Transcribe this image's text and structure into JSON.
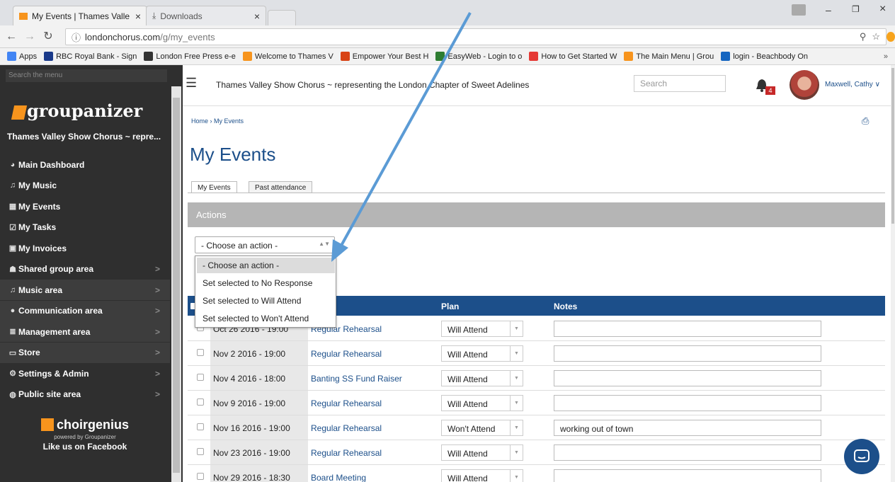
{
  "browser": {
    "tabs": [
      {
        "label": "My Events | Thames Valle"
      },
      {
        "label": "Downloads"
      }
    ],
    "url_prefix": "londonchorus.com",
    "url_path": "/g/my_events",
    "bookmarks": [
      {
        "label": "Apps",
        "color": "#4285f4"
      },
      {
        "label": "RBC Royal Bank - Sign",
        "color": "#1a3a8a"
      },
      {
        "label": "London Free Press e-e",
        "color": "#333333"
      },
      {
        "label": "Welcome to Thames V",
        "color": "#f7941d"
      },
      {
        "label": "Empower Your Best H",
        "color": "#d84315"
      },
      {
        "label": "EasyWeb - Login to o",
        "color": "#2e7d32"
      },
      {
        "label": "How to Get Started W",
        "color": "#e53935"
      },
      {
        "label": "The Main Menu | Grou",
        "color": "#f7941d"
      },
      {
        "label": "login - Beachbody On",
        "color": "#1565c0"
      }
    ],
    "more": "»"
  },
  "sidebar": {
    "search_placeholder": "Search the menu",
    "logo": "groupanizer",
    "org_name": "Thames Valley Show Chorus ~ repre...",
    "items": [
      {
        "label": "Main Dashboard",
        "icon": "dashboard-icon",
        "glyph": "◕",
        "chevron": ""
      },
      {
        "label": "My Music",
        "icon": "music-note-icon",
        "glyph": "♫",
        "chevron": ""
      },
      {
        "label": "My Events",
        "icon": "calendar-icon",
        "glyph": "▦",
        "chevron": ""
      },
      {
        "label": "My Tasks",
        "icon": "checkbox-icon",
        "glyph": "☑",
        "chevron": ""
      },
      {
        "label": "My Invoices",
        "icon": "money-icon",
        "glyph": "▣",
        "chevron": ""
      },
      {
        "label": "Shared group area",
        "icon": "group-icon",
        "glyph": "☗",
        "chevron": ">"
      },
      {
        "label": "Music area",
        "icon": "music-note-icon",
        "glyph": "♫",
        "chevron": ">"
      },
      {
        "label": "Communication area",
        "icon": "chat-icon",
        "glyph": "●",
        "chevron": ">"
      },
      {
        "label": "Management area",
        "icon": "list-icon",
        "glyph": "≣",
        "chevron": ">"
      },
      {
        "label": "Store",
        "icon": "store-icon",
        "glyph": "▭",
        "chevron": ">"
      },
      {
        "label": "Settings & Admin",
        "icon": "cogs-icon",
        "glyph": "⚙",
        "chevron": ">"
      },
      {
        "label": "Public site area",
        "icon": "globe-icon",
        "glyph": "◍",
        "chevron": ">"
      }
    ],
    "choir_brand": "choirgenius",
    "powered_by": "powered by Groupanizer",
    "facebook": "Like us on Facebook"
  },
  "header": {
    "site_title": "Thames Valley Show Chorus ~ representing the London Chapter of Sweet Adelines",
    "search_placeholder": "Search",
    "notification_count": "4",
    "user_name": "Maxwell, Cathy ∨"
  },
  "page": {
    "breadcrumb": "Home › My Events",
    "title": "My Events",
    "tabs": [
      {
        "label": "My Events"
      },
      {
        "label": "Past attendance"
      }
    ],
    "actions_heading": "Actions",
    "action_select_value": "- Choose an action -",
    "action_options": [
      {
        "label": "- Choose an action -"
      },
      {
        "label": "Set selected to No Response"
      },
      {
        "label": "Set selected to Will Attend"
      },
      {
        "label": "Set selected to Won't Attend"
      }
    ]
  },
  "table": {
    "headers": {
      "plan": "Plan",
      "notes": "Notes"
    },
    "rows": [
      {
        "date": "Oct 26 2016 - 19:00",
        "event": "Regular Rehearsal",
        "plan": "Will Attend",
        "note": ""
      },
      {
        "date": "Nov 2 2016 - 19:00",
        "event": "Regular Rehearsal",
        "plan": "Will Attend",
        "note": ""
      },
      {
        "date": "Nov 4 2016 - 18:00",
        "event": "Banting SS Fund Raiser",
        "plan": "Will Attend",
        "note": ""
      },
      {
        "date": "Nov 9 2016 - 19:00",
        "event": "Regular Rehearsal",
        "plan": "Will Attend",
        "note": ""
      },
      {
        "date": "Nov 16 2016 - 19:00",
        "event": "Regular Rehearsal",
        "plan": "Won't Attend",
        "note": "working out of town"
      },
      {
        "date": "Nov 23 2016 - 19:00",
        "event": "Regular Rehearsal",
        "plan": "Will Attend",
        "note": ""
      },
      {
        "date": "Nov 29 2016 - 18:30",
        "event": "Board Meeting",
        "plan": "Will Attend",
        "note": ""
      }
    ]
  },
  "colors": {
    "brand_blue": "#1c4f8a",
    "brand_orange": "#f7941d",
    "annotation_arrow": "#5b9bd5"
  }
}
